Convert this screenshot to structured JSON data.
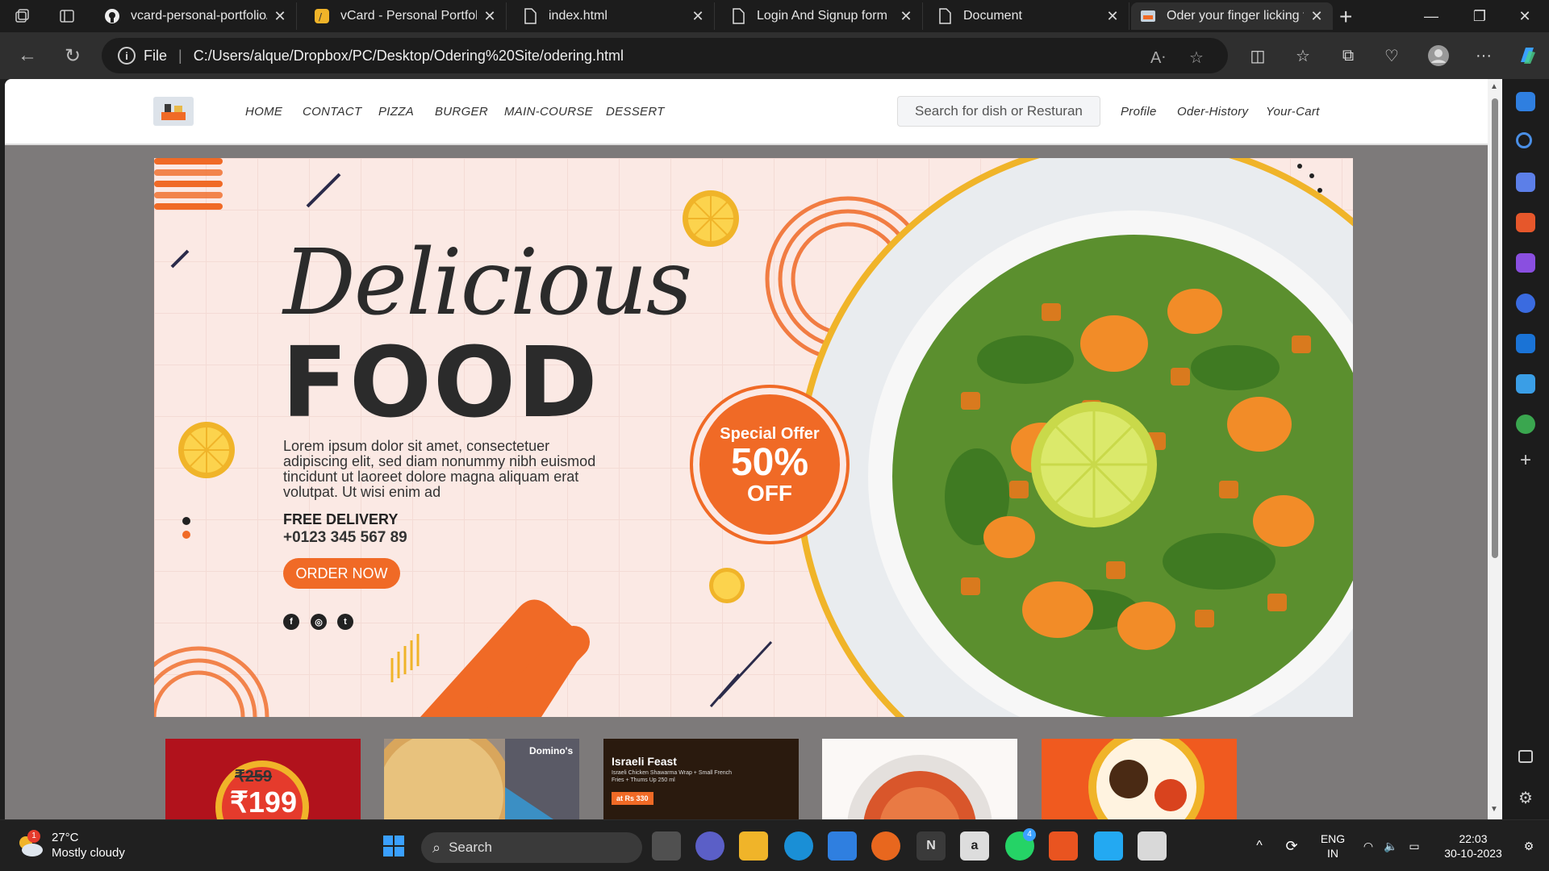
{
  "browser": {
    "tabs": [
      {
        "title": "vcard-personal-portfolio/in",
        "icon": "github-icon"
      },
      {
        "title": "vCard - Personal Portfolio",
        "icon": "vcard-icon"
      },
      {
        "title": "index.html",
        "icon": "document-icon"
      },
      {
        "title": "Login And Signup form",
        "icon": "document-icon"
      },
      {
        "title": "Document",
        "icon": "document-icon"
      },
      {
        "title": "Oder your finger licking fo",
        "icon": "site-icon"
      }
    ],
    "address": {
      "scheme_label": "File",
      "url": "C:/Users/alque/Dropbox/PC/Desktop/Odering%20Site/odering.html"
    }
  },
  "site": {
    "nav": {
      "links": [
        "HOME",
        "CONTACT",
        "PIZZA",
        "BURGER",
        "MAIN-COURSE",
        "DESSERT"
      ],
      "search_placeholder": "Search for dish or Resturan",
      "right_links": [
        "Profile",
        "Oder-History",
        "Your-Cart"
      ]
    },
    "hero": {
      "heading1": "Delicious",
      "heading2": "FOOD",
      "body": "Lorem ipsum dolor sit amet, consectetuer adipiscing elit, sed diam nonummy nibh euismod tincidunt ut laoreet dolore magna aliquam erat volutpat. Ut wisi enim ad",
      "delivery_label": "FREE DELIVERY",
      "phone": "+0123 345 567 89",
      "cta": "ORDER NOW",
      "offer": {
        "line1": "Special Offer",
        "line2": "50%",
        "line3": "OFF"
      },
      "social_icons": [
        "facebook-icon",
        "instagram-icon",
        "twitter-icon"
      ]
    },
    "promo_cards": [
      {
        "name": "price-card",
        "old_price": "₹259",
        "new_price": "₹199"
      },
      {
        "name": "pizza-card",
        "brand": "Domino's"
      },
      {
        "name": "israeli-feast-card",
        "title": "Israeli Feast",
        "desc": "Israeli Chicken Shawarma Wrap + Small French Fries + Thums Up 250 ml",
        "price": "at Rs 330"
      },
      {
        "name": "pasta-card"
      },
      {
        "name": "soup-card"
      }
    ]
  },
  "taskbar": {
    "weather": {
      "temp": "27°C",
      "condition": "Mostly cloudy",
      "badge": "1"
    },
    "search_label": "Search",
    "tray": {
      "lang1": "ENG",
      "lang2": "IN",
      "time": "22:03",
      "date": "30-10-2023"
    },
    "whatsapp_badge": "4"
  },
  "colors": {
    "accent": "#f06a26",
    "hero_bg": "#fbe9e4",
    "page_bg": "#7d7a7a"
  }
}
